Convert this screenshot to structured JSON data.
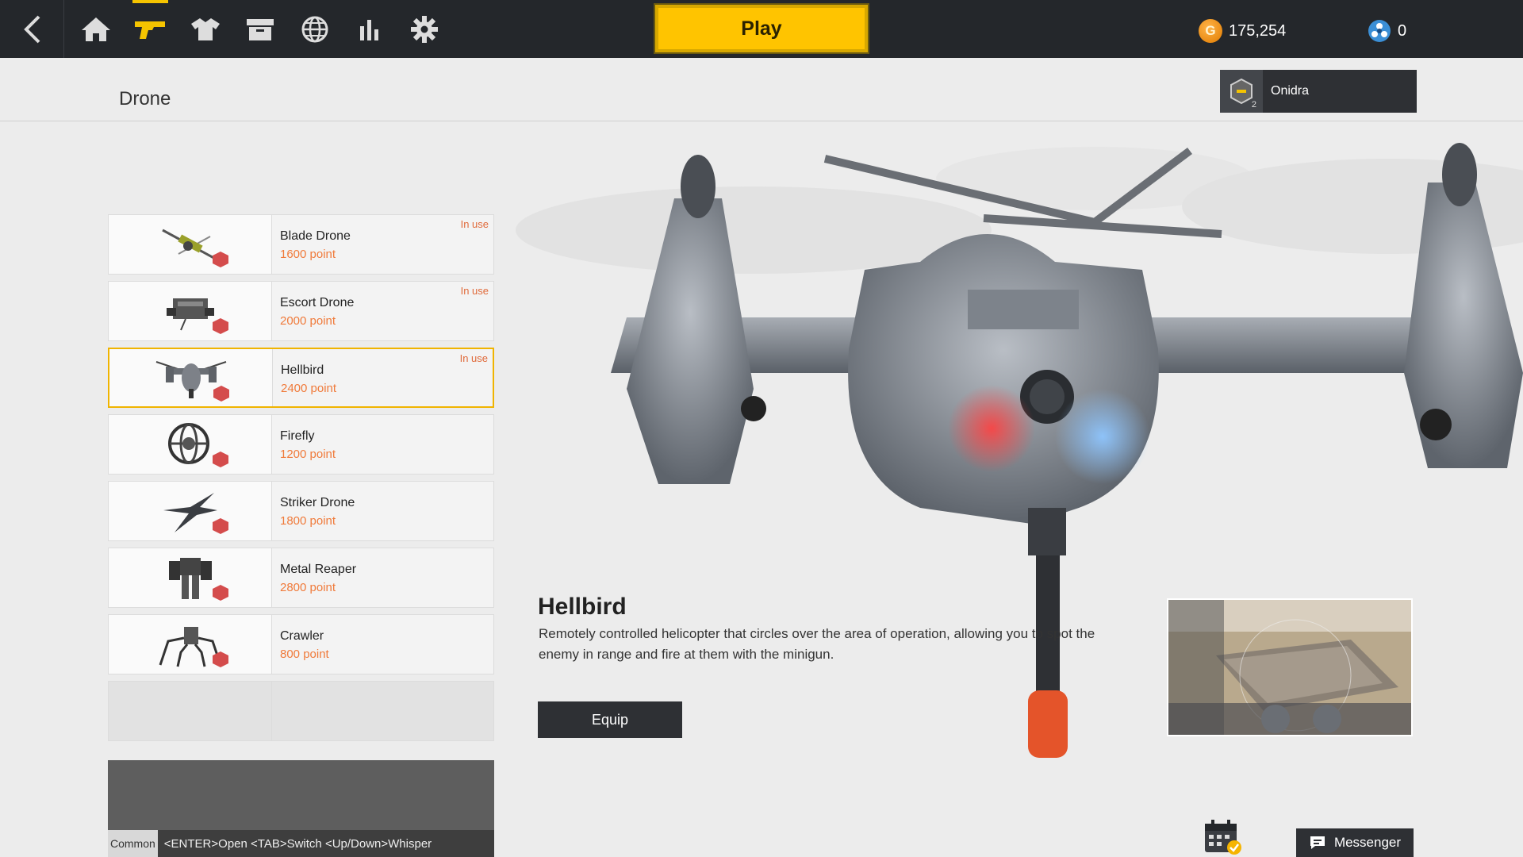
{
  "topbar": {
    "play_label": "Play",
    "gold_amount": "175,254",
    "gold_symbol": "G",
    "gem_amount": "0",
    "nav": [
      {
        "id": "home",
        "icon": "home-icon"
      },
      {
        "id": "weapons",
        "icon": "pistol-icon",
        "active": true
      },
      {
        "id": "outfit",
        "icon": "shirt-icon"
      },
      {
        "id": "storage",
        "icon": "box-icon"
      },
      {
        "id": "world",
        "icon": "globe-icon"
      },
      {
        "id": "stats",
        "icon": "bar-chart-icon"
      },
      {
        "id": "settings",
        "icon": "gear-icon"
      }
    ],
    "accent_color": "#ffc400"
  },
  "header": {
    "page_title": "Drone",
    "profile_name": "Onidra",
    "rank": "2"
  },
  "drones": [
    {
      "name": "Blade Drone",
      "points": "1600 point",
      "status": "In use"
    },
    {
      "name": "Escort Drone",
      "points": "2000 point",
      "status": "In use"
    },
    {
      "name": "Hellbird",
      "points": "2400 point",
      "status": "In use",
      "selected": true
    },
    {
      "name": "Firefly",
      "points": "1200 point",
      "status": ""
    },
    {
      "name": "Striker Drone",
      "points": "1800 point",
      "status": ""
    },
    {
      "name": "Metal Reaper",
      "points": "2800 point",
      "status": ""
    },
    {
      "name": "Crawler",
      "points": "800 point",
      "status": ""
    }
  ],
  "detail": {
    "title": "Hellbird",
    "description": "Remotely controlled helicopter that circles over the area of operation, allowing you to spot the enemy in range and fire at them with the minigun.",
    "equip_label": "Equip"
  },
  "chat": {
    "channel": "Common",
    "hint": "<ENTER>Open <TAB>Switch <Up/Down>Whisper"
  },
  "messenger_label": "Messenger",
  "colors": {
    "points": "#f07a3a",
    "selected_border": "#f0b400"
  }
}
